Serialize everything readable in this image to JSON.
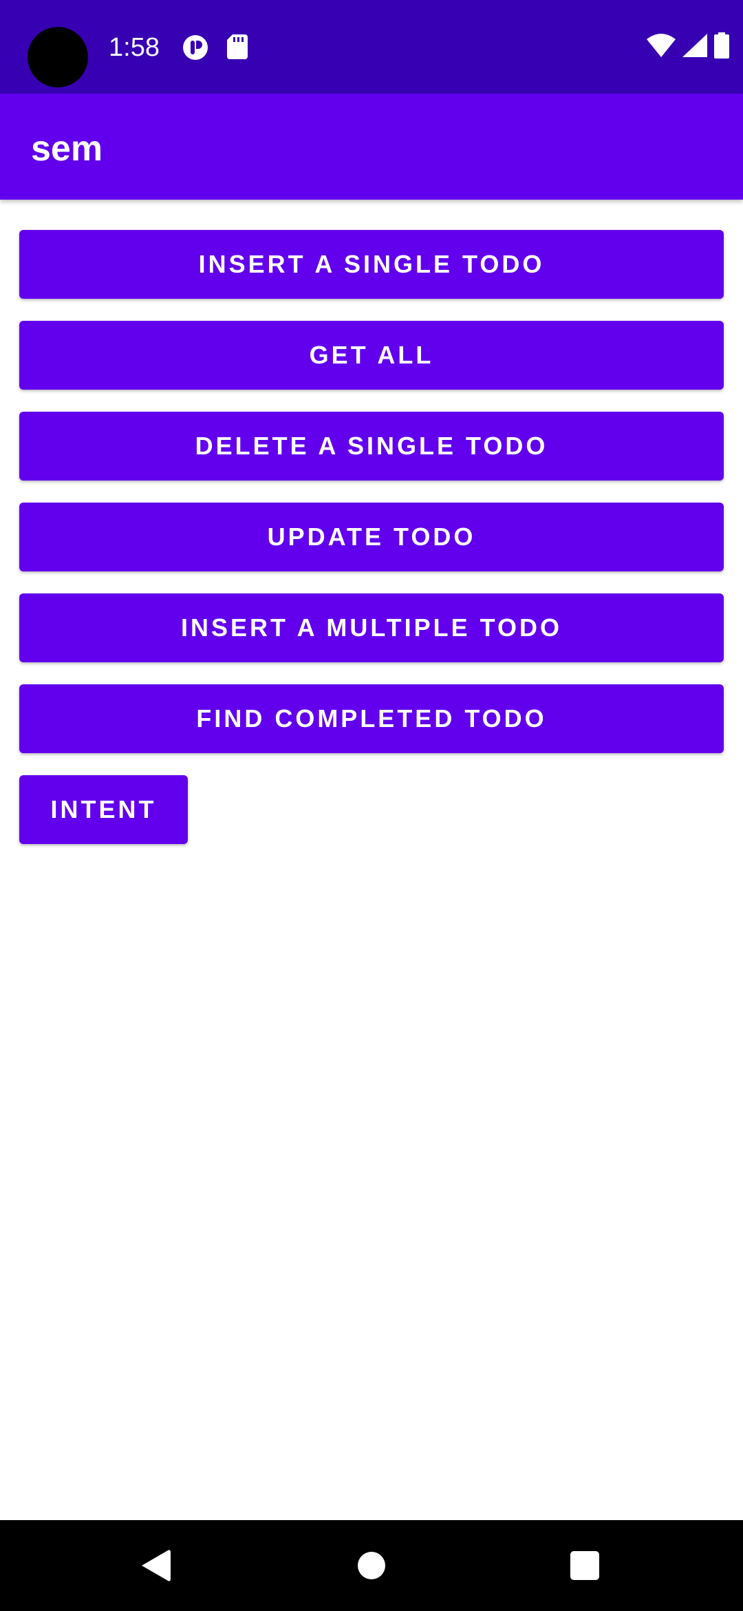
{
  "status_bar": {
    "time": "1:58",
    "icons": [
      "notification-app-icon",
      "sd-card-icon",
      "wifi-icon",
      "cell-signal-icon",
      "battery-icon"
    ],
    "color": "#3700b3"
  },
  "app_bar": {
    "title": "sem",
    "color": "#6200ee"
  },
  "buttons": [
    {
      "label": "INSERT A SINGLE TODO"
    },
    {
      "label": "GET ALL"
    },
    {
      "label": "DELETE A SINGLE TODO"
    },
    {
      "label": "UPDATE TODO"
    },
    {
      "label": "INSERT A MULTIPLE TODO"
    },
    {
      "label": "FIND COMPLETED TODO"
    },
    {
      "label": "INTENT"
    }
  ],
  "nav_bar": {
    "icons": [
      "back-icon",
      "home-icon",
      "recents-icon"
    ]
  }
}
